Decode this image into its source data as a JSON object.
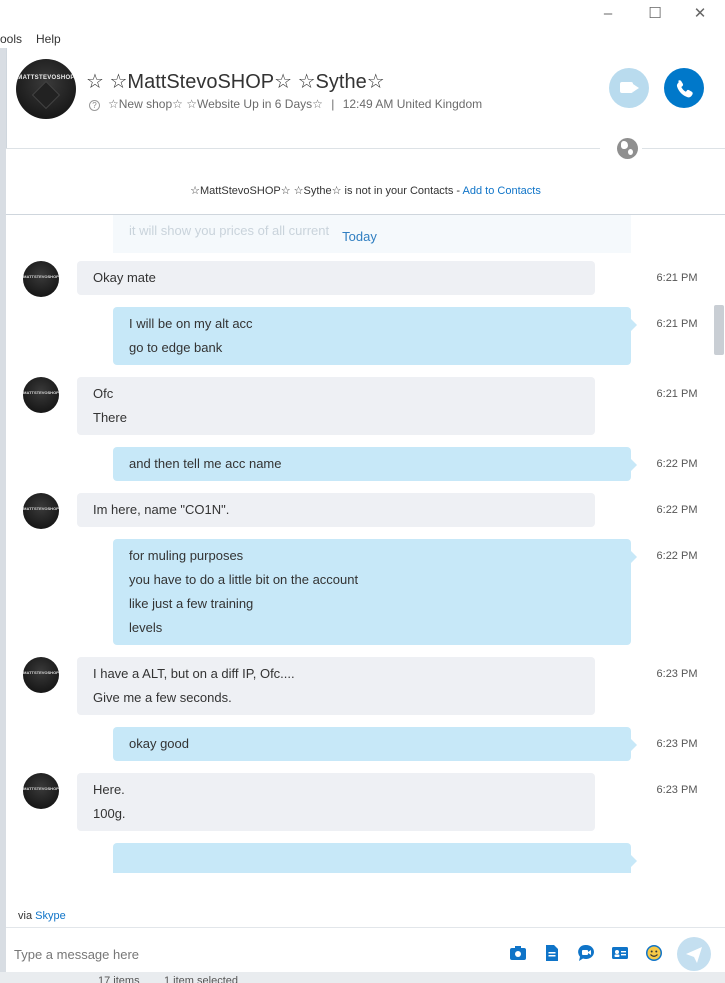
{
  "window": {
    "menu": {
      "tools": "ools",
      "help": "Help"
    },
    "min_icon": "minimize-icon",
    "max_icon": "maximize-icon",
    "close_icon": "close-icon"
  },
  "header": {
    "contact_name": "☆ ☆MattStevoSHOP☆ ☆Sythe☆",
    "status_message": "☆New shop☆ ☆Website Up in 6 Days☆",
    "separator": "|",
    "local_time": "12:49 AM United Kingdom",
    "avatar_text": "MATTSTEVOSHOP",
    "video_call_icon": "video-camera-icon",
    "audio_call_icon": "phone-icon"
  },
  "notice": {
    "text": "☆MattStevoSHOP☆ ☆Sythe☆ is not in your Contacts - ",
    "link": "Add to Contacts"
  },
  "chat": {
    "faded_text": "it will show you prices of all current",
    "day_label": "Today",
    "messages": [
      {
        "dir": "in",
        "lines": [
          "Okay mate"
        ],
        "time": "6:21 PM"
      },
      {
        "dir": "out",
        "lines": [
          "I will be on my alt acc",
          "go to edge bank"
        ],
        "time": "6:21 PM"
      },
      {
        "dir": "in",
        "lines": [
          "Ofc",
          "There"
        ],
        "time": "6:21 PM"
      },
      {
        "dir": "out",
        "lines": [
          "and then tell me acc name"
        ],
        "time": "6:22 PM"
      },
      {
        "dir": "in",
        "lines": [
          "Im here, name \"CO1N\"."
        ],
        "time": "6:22 PM"
      },
      {
        "dir": "out",
        "lines": [
          "for muling purposes",
          "you have to do a little bit on the account",
          "like just a few training",
          "levels"
        ],
        "time": "6:22 PM"
      },
      {
        "dir": "in",
        "lines": [
          "I have a ALT, but on a diff IP, Ofc....",
          "Give me a few seconds."
        ],
        "time": "6:23 PM"
      },
      {
        "dir": "out",
        "lines": [
          "okay good"
        ],
        "time": "6:23 PM"
      },
      {
        "dir": "in",
        "lines": [
          "Here.",
          "100g."
        ],
        "time": "6:23 PM"
      }
    ]
  },
  "footer": {
    "via_prefix": "via ",
    "via_link": "Skype",
    "compose_placeholder": "Type a message here",
    "tools": [
      "media-gallery-icon",
      "file-icon",
      "video-message-icon",
      "contact-card-icon",
      "emoticon-icon",
      "send-icon"
    ],
    "taskbar_peek": [
      "17 items",
      "1 item selected"
    ]
  },
  "colors": {
    "accent": "#0078ca",
    "outgoing_bubble": "#c7e8f8",
    "incoming_bubble": "#eef0f4",
    "link": "#0f74c8"
  }
}
